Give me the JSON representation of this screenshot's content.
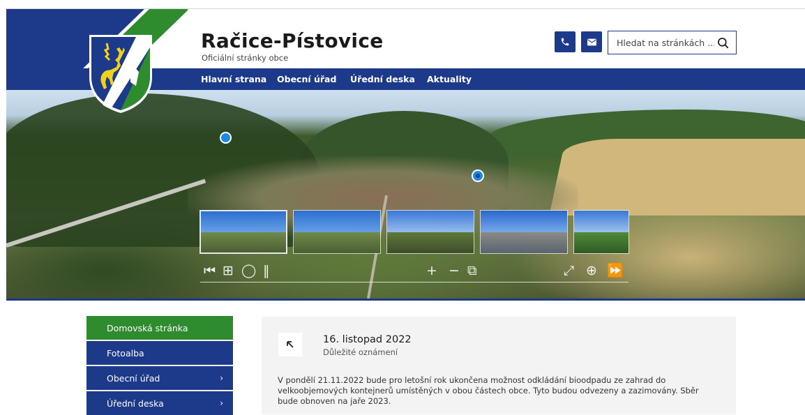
{
  "site": {
    "title": "Račice-Pístovice",
    "subtitle": "Oficiální stránky obce"
  },
  "header": {
    "phone_icon": "phone-icon",
    "mail_icon": "mail-icon",
    "search_placeholder": "Hledat na stránkách ...",
    "search_icon": "search-icon"
  },
  "nav": {
    "items": [
      "Hlavní strana",
      "Obecní úřad",
      "Úřední deska",
      "Aktuality"
    ]
  },
  "panorama": {
    "controls": [
      "skip-back-icon",
      "grid-icon",
      "circle-icon",
      "pause-icon",
      "plus-icon",
      "minus-icon",
      "vr-icon",
      "fullscreen-icon",
      "download-icon",
      "forward-icon"
    ],
    "thumbnail_count": 5
  },
  "sidebar": {
    "items": [
      {
        "label": "Domovská stránka",
        "active": true,
        "has_children": false
      },
      {
        "label": "Fotoalba",
        "active": false,
        "has_children": false
      },
      {
        "label": "Obecní úřad",
        "active": false,
        "has_children": true
      },
      {
        "label": "Úřední deska",
        "active": false,
        "has_children": true
      }
    ]
  },
  "news": {
    "date": "16. listopad 2022",
    "category": "Důležité oznámení",
    "text": "V pondělí 21.11.2022 bude pro letošní rok ukončena možnost odkládání bioodpadu ze zahrad do velkoobjemových kontejnerů umístěných v obou částech obce. Tyto budou odvezeny a zazimovány. Sběr bude obnoven na jaře 2023."
  },
  "colors": {
    "brand_blue": "#1d3a8a",
    "brand_green": "#2e8b2e"
  }
}
